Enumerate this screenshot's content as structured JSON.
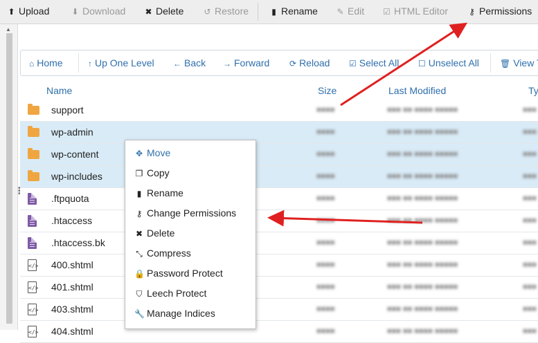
{
  "toolbar": {
    "upload": "Upload",
    "download": "Download",
    "delete": "Delete",
    "restore": "Restore",
    "rename": "Rename",
    "edit": "Edit",
    "html_editor": "HTML Editor",
    "permissions": "Permissions"
  },
  "nav": {
    "home": "Home",
    "up_one_level": "Up One Level",
    "back": "Back",
    "forward": "Forward",
    "reload": "Reload",
    "select_all": "Select All",
    "unselect_all": "Unselect All",
    "view_trash": "View T"
  },
  "table": {
    "col_name": "Name",
    "col_size": "Size",
    "col_modified": "Last Modified",
    "col_type": "Ty",
    "rows": [
      {
        "name": "support",
        "kind": "folder",
        "selected": false
      },
      {
        "name": "wp-admin",
        "kind": "folder",
        "selected": true
      },
      {
        "name": "wp-content",
        "kind": "folder",
        "selected": true
      },
      {
        "name": "wp-includes",
        "kind": "folder",
        "selected": true
      },
      {
        "name": ".ftpquota",
        "kind": "file",
        "selected": false
      },
      {
        "name": ".htaccess",
        "kind": "file",
        "selected": false
      },
      {
        "name": ".htaccess.bk",
        "kind": "file",
        "selected": false
      },
      {
        "name": "400.shtml",
        "kind": "code",
        "selected": false
      },
      {
        "name": "401.shtml",
        "kind": "code",
        "selected": false
      },
      {
        "name": "403.shtml",
        "kind": "code",
        "selected": false
      },
      {
        "name": "404.shtml",
        "kind": "code",
        "selected": false
      }
    ]
  },
  "context_menu": {
    "move": "Move",
    "copy": "Copy",
    "rename": "Rename",
    "change_permissions": "Change Permissions",
    "delete": "Delete",
    "compress": "Compress",
    "password_protect": "Password Protect",
    "leech_protect": "Leech Protect",
    "manage_indices": "Manage Indices"
  },
  "colors": {
    "accent": "#2f6fab",
    "selected_row": "#d9ebf7",
    "folder": "#f0a640",
    "file": "#7e5aa6",
    "arrow": "#e02020"
  },
  "icons": {
    "upload": "upload-icon",
    "download": "download-icon",
    "delete": "close-icon",
    "restore": "restore-icon",
    "rename": "file-icon",
    "edit": "pencil-icon",
    "html_editor": "edit-box-icon",
    "permissions": "key-icon"
  }
}
